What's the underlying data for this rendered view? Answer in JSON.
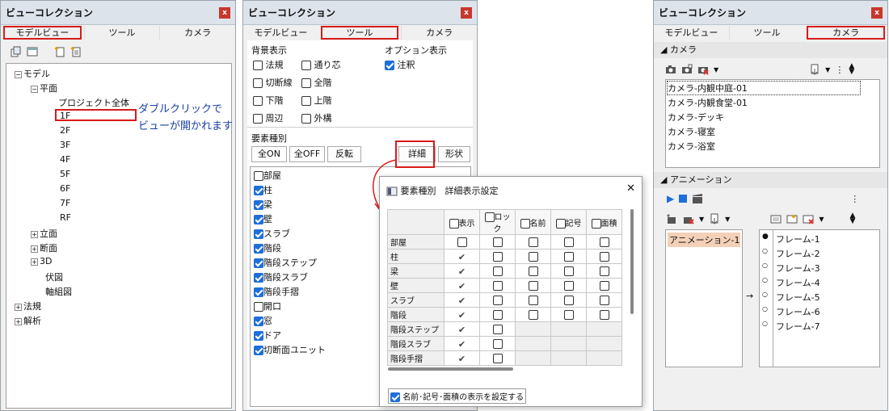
{
  "panel_title": "ビューコレクション",
  "close": "x",
  "tabs": [
    "モデルビュー",
    "ツール",
    "カメラ"
  ],
  "tree": {
    "model": "モデル",
    "plan": "平面",
    "project_all": "プロジェクト全体",
    "floors": [
      "1F",
      "2F",
      "3F",
      "4F",
      "5F",
      "6F",
      "7F",
      "RF"
    ],
    "elevation": "立面",
    "section": "断面",
    "d3": "3D",
    "fuse": "伏図",
    "axis": "軸組図",
    "regulation": "法規",
    "analysis": "解析"
  },
  "annotation": [
    "ダブルクリックで",
    "ビューが開かれます"
  ],
  "tool": {
    "bg_title": "背景表示",
    "bg": [
      "法規",
      "通り芯",
      "切断線",
      "全階",
      "下階",
      "上階",
      "周辺",
      "外構"
    ],
    "opt_title": "オプション表示",
    "opt": "注釈",
    "elem_title": "要素種別",
    "btn_allon": "全ON",
    "btn_alloff": "全OFF",
    "btn_invert": "反転",
    "btn_detail": "詳細",
    "btn_shape": "形状",
    "elements": [
      {
        "l": "部屋",
        "c": false
      },
      {
        "l": "柱",
        "c": true
      },
      {
        "l": "梁",
        "c": true
      },
      {
        "l": "壁",
        "c": true
      },
      {
        "l": "スラブ",
        "c": true
      },
      {
        "l": "階段",
        "c": true
      },
      {
        "l": "階段ステップ",
        "c": true
      },
      {
        "l": "階段スラブ",
        "c": true
      },
      {
        "l": "階段手摺",
        "c": true
      },
      {
        "l": "開口",
        "c": false
      },
      {
        "l": "窓",
        "c": true
      },
      {
        "l": "ドア",
        "c": true
      },
      {
        "l": "切断面ユニット",
        "c": true
      }
    ]
  },
  "dialog": {
    "title": "要素種別　詳細表示設定",
    "close": "✕",
    "cols": [
      "表示",
      "ロック",
      "名前",
      "記号",
      "面積"
    ],
    "rows": [
      {
        "l": "部屋",
        "v": [
          0,
          0,
          0,
          0,
          0
        ]
      },
      {
        "l": "柱",
        "v": [
          1,
          0,
          0,
          0,
          0
        ]
      },
      {
        "l": "梁",
        "v": [
          1,
          0,
          0,
          0,
          0
        ]
      },
      {
        "l": "壁",
        "v": [
          1,
          0,
          0,
          0,
          0
        ]
      },
      {
        "l": "スラブ",
        "v": [
          1,
          0,
          0,
          0,
          0
        ]
      },
      {
        "l": "階段",
        "v": [
          1,
          0,
          0,
          0,
          0
        ]
      },
      {
        "l": "階段ステップ",
        "v": [
          1,
          0,
          null,
          null,
          null
        ]
      },
      {
        "l": "階段スラブ",
        "v": [
          1,
          0,
          null,
          null,
          null
        ]
      },
      {
        "l": "階段手摺",
        "v": [
          1,
          0,
          null,
          null,
          null
        ]
      }
    ],
    "footer": "名前･記号･面積の表示を設定する"
  },
  "camera": {
    "section": "カメラ",
    "list": [
      "カメラ-内観中庭-01",
      "カメラ-内観食堂-01",
      "カメラ-デッキ",
      "カメラ-寝室",
      "カメラ-浴室"
    ],
    "anim_section": "アニメーション",
    "anims": [
      "アニメーション-1"
    ],
    "frames": [
      "フレーム-1",
      "フレーム-2",
      "フレーム-3",
      "フレーム-4",
      "フレーム-5",
      "フレーム-6",
      "フレーム-7"
    ],
    "arrow": "→"
  },
  "colors": {
    "accent": "#d81b1b",
    "check": "#1e6fd9"
  }
}
